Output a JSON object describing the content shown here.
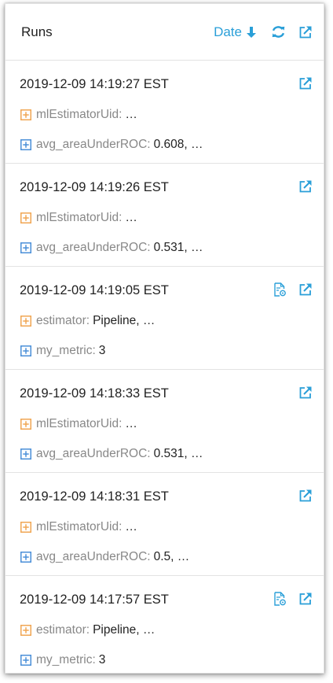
{
  "header": {
    "title": "Runs",
    "sort_label": "Date"
  },
  "colors": {
    "accent": "#2a9fd8",
    "param_expander": "#f0a653",
    "metric_expander": "#4a8fd8"
  },
  "runs": [
    {
      "date": "2019-12-09 14:19:27 EST",
      "has_model_icon": false,
      "param": {
        "key": "mlEstimatorUid",
        "sep": ":",
        "value": "…"
      },
      "metric": {
        "key": "avg_areaUnderROC",
        "sep": ":",
        "value": "0.608, …"
      }
    },
    {
      "date": "2019-12-09 14:19:26 EST",
      "has_model_icon": false,
      "param": {
        "key": "mlEstimatorUid",
        "sep": ":",
        "value": "…"
      },
      "metric": {
        "key": "avg_areaUnderROC",
        "sep": ":",
        "value": "0.531, …"
      }
    },
    {
      "date": "2019-12-09 14:19:05 EST",
      "has_model_icon": true,
      "param": {
        "key": "estimator",
        "sep": ":",
        "value": "Pipeline, …"
      },
      "metric": {
        "key": "my_metric",
        "sep": ":",
        "value": "3"
      }
    },
    {
      "date": "2019-12-09 14:18:33 EST",
      "has_model_icon": false,
      "param": {
        "key": "mlEstimatorUid",
        "sep": ":",
        "value": "…"
      },
      "metric": {
        "key": "avg_areaUnderROC",
        "sep": ":",
        "value": "0.531, …"
      }
    },
    {
      "date": "2019-12-09 14:18:31 EST",
      "has_model_icon": false,
      "param": {
        "key": "mlEstimatorUid",
        "sep": ":",
        "value": "…"
      },
      "metric": {
        "key": "avg_areaUnderROC",
        "sep": ":",
        "value": "0.5, …"
      }
    },
    {
      "date": "2019-12-09 14:17:57 EST",
      "has_model_icon": true,
      "param": {
        "key": "estimator",
        "sep": ":",
        "value": "Pipeline, …"
      },
      "metric": {
        "key": "my_metric",
        "sep": ":",
        "value": "3"
      }
    }
  ]
}
